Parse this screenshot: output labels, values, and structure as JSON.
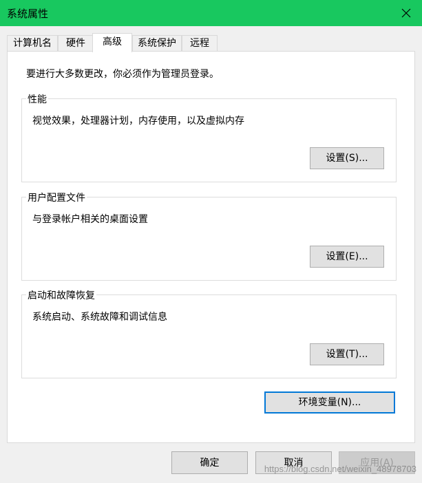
{
  "window": {
    "title": "系统属性",
    "close_icon": "close-icon"
  },
  "tabs": [
    {
      "label": "计算机名",
      "active": false
    },
    {
      "label": "硬件",
      "active": false
    },
    {
      "label": "高级",
      "active": true
    },
    {
      "label": "系统保护",
      "active": false
    },
    {
      "label": "远程",
      "active": false
    }
  ],
  "panel": {
    "admin_note": "要进行大多数更改，你必须作为管理员登录。",
    "groups": [
      {
        "title": "性能",
        "description": "视觉效果，处理器计划，内存使用，以及虚拟内存",
        "button": "设置(S)..."
      },
      {
        "title": "用户配置文件",
        "description": "与登录帐户相关的桌面设置",
        "button": "设置(E)..."
      },
      {
        "title": "启动和故障恢复",
        "description": "系统启动、系统故障和调试信息",
        "button": "设置(T)..."
      }
    ],
    "env_button": "环境变量(N)..."
  },
  "footer": {
    "ok": "确定",
    "cancel": "取消",
    "apply": "应用(A)",
    "apply_disabled": true
  },
  "watermark": "https://blog.csdn.net/weixin_48978703",
  "colors": {
    "titlebar": "#18c85f",
    "focus_border": "#0078d7"
  }
}
